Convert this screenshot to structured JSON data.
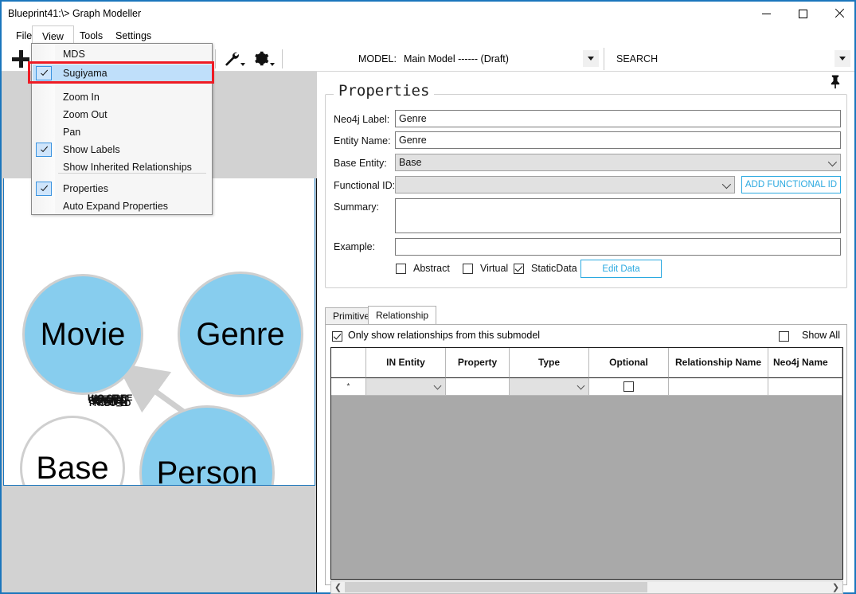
{
  "window": {
    "title": "Blueprint41:\\> Graph Modeller",
    "minimize": "—",
    "maximize": "□",
    "close": "✕"
  },
  "menubar": {
    "items": [
      {
        "label": "File"
      },
      {
        "label": "View"
      },
      {
        "label": "Tools"
      },
      {
        "label": "Settings"
      }
    ]
  },
  "view_menu": {
    "items": [
      {
        "label": "MDS",
        "checked": false
      },
      {
        "label": "Sugiyama",
        "checked": true,
        "selected": true
      },
      {
        "label": "Zoom In",
        "checked": false
      },
      {
        "label": "Zoom Out",
        "checked": false
      },
      {
        "label": "Pan",
        "checked": false
      },
      {
        "label": "Show Labels",
        "checked": true
      },
      {
        "label": "Show Inherited Relationships",
        "checked": false
      },
      {
        "label": "Properties",
        "checked": true
      },
      {
        "label": "Auto Expand Properties",
        "checked": false
      }
    ],
    "highlight_color": "#ee1c25",
    "selection_color": "#bfdffa"
  },
  "toolbar": {
    "add_icon": "plus-icon",
    "wrench_icon": "wrench-icon",
    "gear_icon": "gear-icon",
    "model_label": "MODEL:",
    "model_value": "Main Model ------ (Draft)",
    "search_value": "SEARCH"
  },
  "canvas": {
    "nodes": [
      {
        "id": "movie",
        "label": "Movie",
        "filled": true
      },
      {
        "id": "genre",
        "label": "Genre",
        "filled": true
      },
      {
        "id": "base",
        "label": "Base",
        "filled": false
      },
      {
        "id": "person",
        "label": "Person",
        "filled": true
      }
    ],
    "edge_labels": [
      "HAS_GENRE",
      "DIRECTED",
      "PRODUCED",
      "ACTED_IN",
      "REVIEWED",
      "WROTE"
    ],
    "node_fill_color": "#87cdee",
    "node_border_color": "#cfcfcf"
  },
  "properties": {
    "legend": "Properties",
    "pin_icon": "pushpin-icon",
    "fields": {
      "neo4j_label": {
        "label": "Neo4j Label:",
        "value": "Genre"
      },
      "entity_name": {
        "label": "Entity Name:",
        "value": "Genre"
      },
      "base_entity": {
        "label": "Base Entity:",
        "value": "Base"
      },
      "functional_id": {
        "label": "Functional ID:",
        "value": ""
      },
      "summary": {
        "label": "Summary:",
        "value": ""
      },
      "example": {
        "label": "Example:",
        "value": ""
      }
    },
    "add_functional_id_label": "ADD FUNCTIONAL ID",
    "checkboxes": [
      {
        "label": "Abstract",
        "checked": false
      },
      {
        "label": "Virtual",
        "checked": false
      },
      {
        "label": "StaticData",
        "checked": true
      }
    ],
    "edit_data_label": "Edit Data",
    "accent_color": "#2ba9e0"
  },
  "tabs": {
    "items": [
      {
        "label": "Primitive",
        "active": false
      },
      {
        "label": "Relationship",
        "active": true
      }
    ]
  },
  "relationships": {
    "only_submodel": {
      "label": "Only show relationships from this submodel",
      "checked": true
    },
    "show_all": {
      "label": "Show All",
      "checked": false
    },
    "columns": [
      "",
      "IN Entity",
      "Property",
      "Type",
      "Optional",
      "Relationship\nName",
      "Neo4j\nName"
    ],
    "columns_display": [
      "",
      "IN Entity",
      "Property",
      "Type",
      "Optional",
      "Relationship Name",
      "Neo4j Name"
    ],
    "rows": [
      {
        "marker": "*",
        "in_entity": "",
        "property": "",
        "type": "",
        "optional": false,
        "relationship_name": "",
        "neo4j_name": ""
      }
    ],
    "scroll_left_icon": "chevron-left-icon",
    "scroll_right_icon": "chevron-right-icon"
  }
}
